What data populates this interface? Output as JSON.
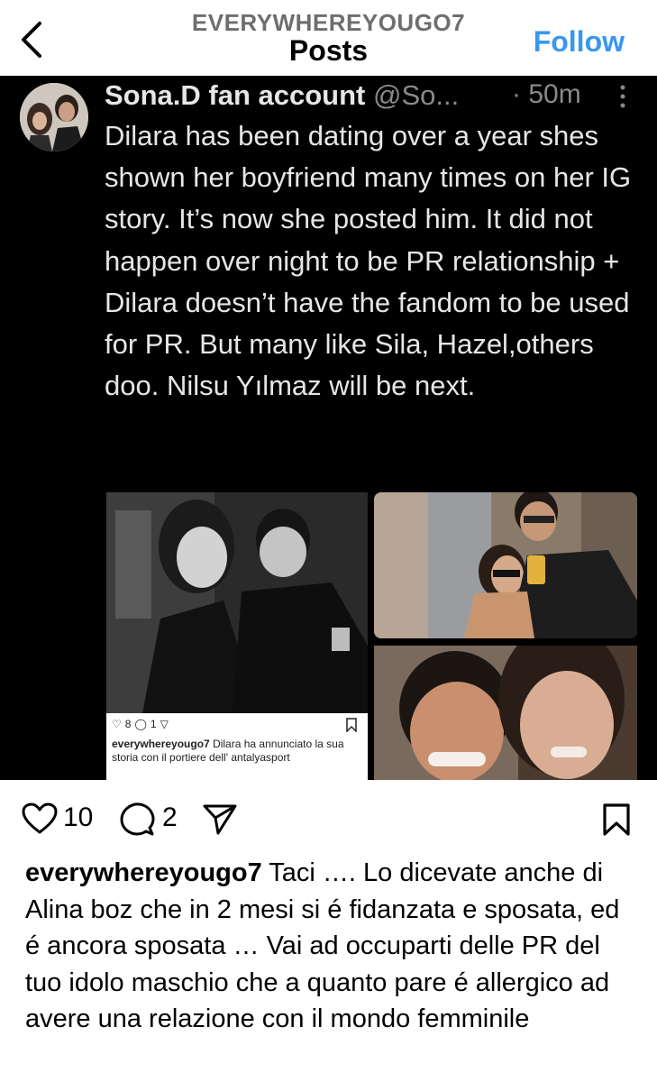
{
  "header": {
    "username": "EVERYWHEREYOUGO7",
    "title": "Posts",
    "follow_label": "Follow"
  },
  "tweet": {
    "display_name": "Sona.D fan account",
    "handle": "@So...",
    "time": "· 50m",
    "text": "Dilara has been dating over a year shes shown her boyfriend many times on her IG story. It’s now she posted him. It did not happen over night to be PR relationship + Dilara doesn’t have the fandom to be used for PR. But many like Sila, Hazel,others doo. Nilsu Yılmaz will be next.",
    "embedded_post": {
      "likes": "8",
      "comments": "1",
      "caption_user": "everywhereyougo7",
      "caption_text": "Dilara ha annunciato la sua storia con il portiere dell' antalyasport"
    }
  },
  "actions": {
    "like_count": "10",
    "comment_count": "2"
  },
  "caption": {
    "username": "everywhereyougo7",
    "text": "Taci …. Lo dicevate anche di Alina boz che in 2 mesi si é fidanzata e sposata, ed é ancora sposata … Vai ad occuparti delle PR del tuo idolo maschio che a quanto pare é allergico ad avere una relazione con il mondo femminile"
  },
  "colors": {
    "follow": "#3897f0",
    "tweet_bg": "#000000",
    "tweet_text": "#e6e6e6",
    "tweet_muted": "#8a8a8a"
  }
}
